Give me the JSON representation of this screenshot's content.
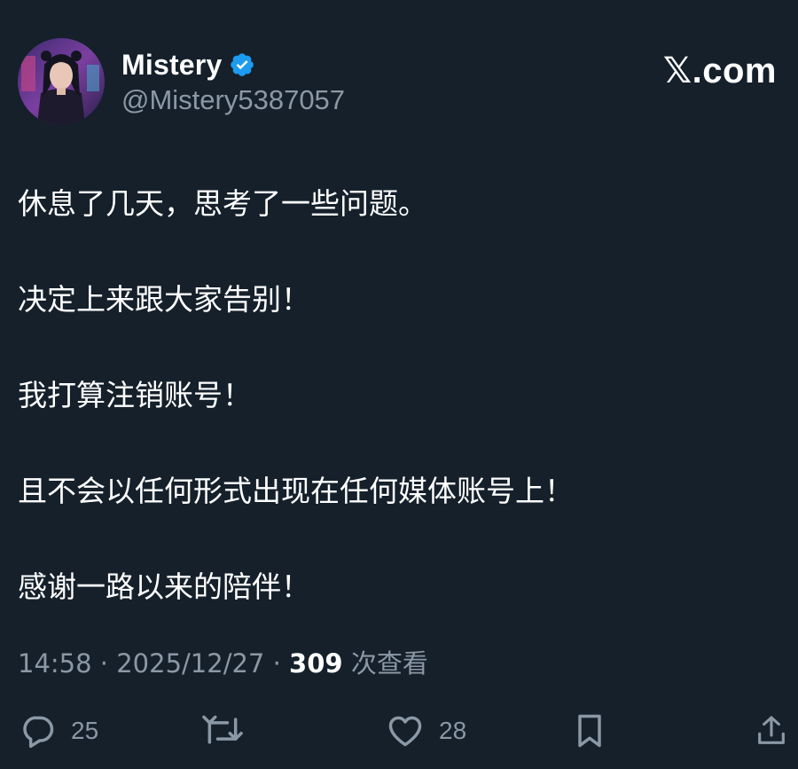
{
  "author": {
    "display_name": "Mistery",
    "handle": "@Mistery5387057",
    "verified": true,
    "verified_color": "#1d9bf0"
  },
  "brand": {
    "mark": "𝕏",
    "suffix": ".com"
  },
  "post": {
    "paragraphs": [
      "休息了几天，思考了一些问题。",
      "决定上来跟大家告别！",
      "我打算注销账号！",
      "且不会以任何形式出现在任何媒体账号上！",
      "感谢一路以来的陪伴！"
    ]
  },
  "meta": {
    "time": "14:58",
    "date": "2025/12/27",
    "separator": "·",
    "views_count": "309",
    "views_label": "次查看"
  },
  "actions": {
    "reply": {
      "icon": "reply-icon",
      "count": "25"
    },
    "repost": {
      "icon": "repost-icon"
    },
    "like": {
      "icon": "heart-icon",
      "count": "28"
    },
    "bookmark": {
      "icon": "bookmark-icon"
    },
    "share": {
      "icon": "share-icon"
    }
  },
  "colors": {
    "background": "#15202b",
    "text": "#ffffff",
    "secondary": "#8b98a5"
  }
}
